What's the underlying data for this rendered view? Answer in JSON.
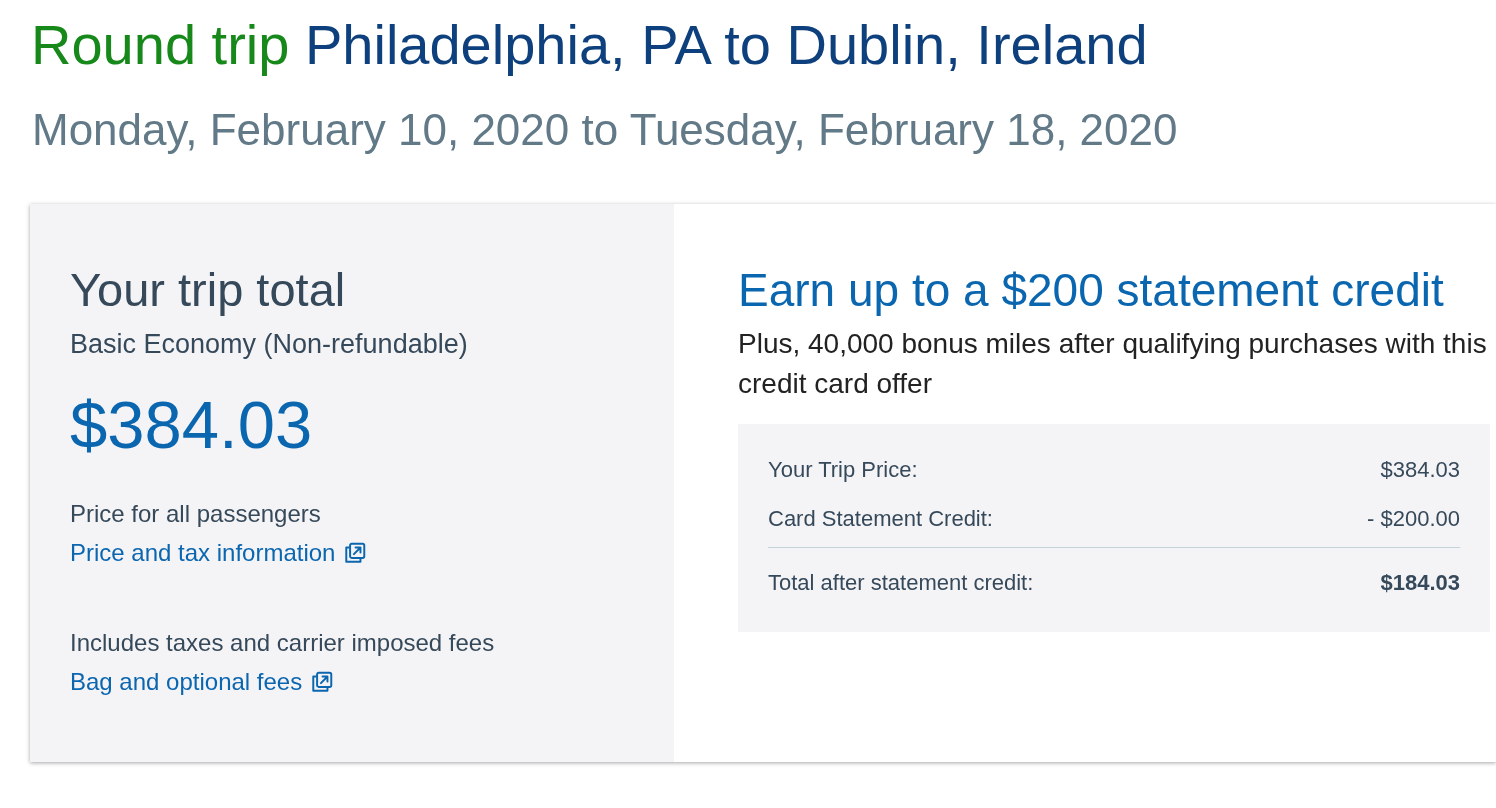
{
  "header": {
    "trip_type": "Round trip",
    "route": "Philadelphia, PA to Dublin, Ireland",
    "dates": "Monday, February 10, 2020 to Tuesday, February 18, 2020"
  },
  "trip_total": {
    "title": "Your trip total",
    "fare_type": "Basic Economy (Non-refundable)",
    "price": "$384.03",
    "sections": [
      {
        "note": "Price for all passengers",
        "link": "Price and tax information"
      },
      {
        "note": "Includes taxes and carrier imposed fees",
        "link": "Bag and optional fees"
      }
    ]
  },
  "offer": {
    "title": "Earn up to a $200 statement credit",
    "subtitle": "Plus, 40,000 bonus miles after qualifying purchases with this credit card offer",
    "summary": [
      {
        "kind": "line",
        "label": "Your Trip Price:",
        "value": "$384.03"
      },
      {
        "kind": "line",
        "label": "Card Statement Credit:",
        "value": "- $200.00"
      },
      {
        "kind": "total",
        "label": "Total after statement credit:",
        "value": "$184.03"
      }
    ]
  }
}
